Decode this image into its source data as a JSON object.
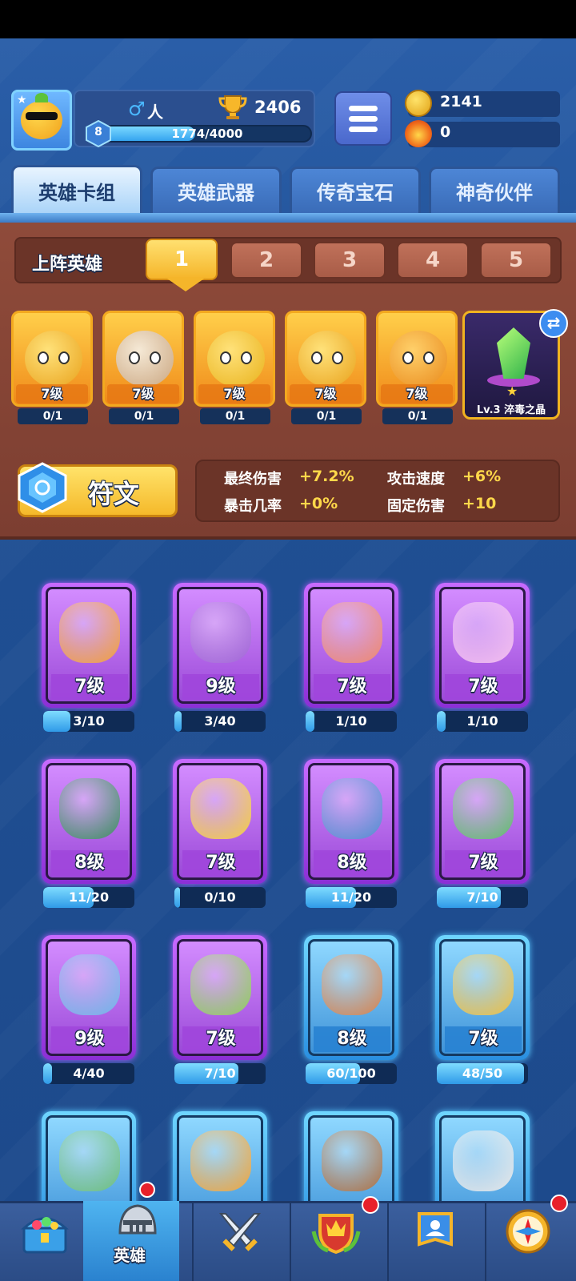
{
  "player": {
    "gender_icon": "male-icon",
    "name": "人",
    "trophies": "2406",
    "level": "8",
    "xp_text": "1774/4000",
    "xp_fraction": 0.4435
  },
  "currency": {
    "coins": "2141",
    "gems": "0"
  },
  "tabs": [
    {
      "label": "英雄卡组",
      "active": true
    },
    {
      "label": "英雄武器",
      "active": false
    },
    {
      "label": "传奇宝石",
      "active": false
    },
    {
      "label": "神奇伙伴",
      "active": false
    }
  ],
  "deck": {
    "label": "上阵英雄",
    "slots": [
      "1",
      "2",
      "3",
      "4",
      "5"
    ],
    "active_slot": "1",
    "heroes": [
      {
        "level": "7级",
        "progress": "0/1"
      },
      {
        "level": "7级",
        "progress": "0/1"
      },
      {
        "level": "7级",
        "progress": "0/1"
      },
      {
        "level": "7级",
        "progress": "0/1"
      },
      {
        "level": "7级",
        "progress": "0/1"
      }
    ],
    "crystal_label": "Lv.3 淬毒之晶"
  },
  "rune": {
    "label": "符文"
  },
  "stats": [
    {
      "name": "最终伤害",
      "value": "+7.2%"
    },
    {
      "name": "攻击速度",
      "value": "+6%"
    },
    {
      "name": "暴击几率",
      "value": "+0%"
    },
    {
      "name": "固定伤害",
      "value": "+10"
    }
  ],
  "collection": [
    {
      "level": "7级",
      "progress": "3/10",
      "fraction": 0.3,
      "rarity": "epic",
      "color": "#f2a13a"
    },
    {
      "level": "9级",
      "progress": "3/40",
      "fraction": 0.075,
      "rarity": "epic",
      "color": "#a066d6"
    },
    {
      "level": "7级",
      "progress": "1/10",
      "fraction": 0.1,
      "rarity": "epic",
      "color": "#f08a6a"
    },
    {
      "level": "7级",
      "progress": "1/10",
      "fraction": 0.1,
      "rarity": "epic",
      "color": "#f5c0f0"
    },
    {
      "level": "8级",
      "progress": "11/20",
      "fraction": 0.55,
      "rarity": "epic",
      "color": "#3c8f60"
    },
    {
      "level": "7级",
      "progress": "0/10",
      "fraction": 0.0,
      "rarity": "epic",
      "color": "#f5d040"
    },
    {
      "level": "8级",
      "progress": "11/20",
      "fraction": 0.55,
      "rarity": "epic",
      "color": "#4f8fd0"
    },
    {
      "level": "7级",
      "progress": "7/10",
      "fraction": 0.7,
      "rarity": "epic",
      "color": "#5fbf6a"
    },
    {
      "level": "9级",
      "progress": "4/40",
      "fraction": 0.1,
      "rarity": "epic",
      "color": "#6fb6e8"
    },
    {
      "level": "7级",
      "progress": "7/10",
      "fraction": 0.7,
      "rarity": "epic",
      "color": "#8fcf5a"
    },
    {
      "level": "8级",
      "progress": "60/100",
      "fraction": 0.6,
      "rarity": "rare",
      "color": "#d9824a"
    },
    {
      "level": "7级",
      "progress": "48/50",
      "fraction": 0.96,
      "rarity": "rare",
      "color": "#f0c040"
    },
    {
      "level": "",
      "progress": "",
      "fraction": 0,
      "rarity": "rare",
      "color": "#6fc07a"
    },
    {
      "level": "",
      "progress": "",
      "fraction": 0,
      "rarity": "rare",
      "color": "#f2a63a"
    },
    {
      "level": "",
      "progress": "",
      "fraction": 0,
      "rarity": "rare",
      "color": "#b07040"
    },
    {
      "level": "",
      "progress": "",
      "fraction": 0,
      "rarity": "rare",
      "color": "#e8e8e8"
    }
  ],
  "nav": {
    "items": [
      {
        "icon": "treasure-chest-icon",
        "label": ""
      },
      {
        "icon": "knight-helmet-icon",
        "label": "英雄"
      },
      {
        "icon": "crossed-swords-icon",
        "label": ""
      },
      {
        "icon": "crown-shield-icon",
        "label": ""
      },
      {
        "icon": "guild-banner-icon",
        "label": ""
      },
      {
        "icon": "compass-icon",
        "label": ""
      }
    ]
  }
}
